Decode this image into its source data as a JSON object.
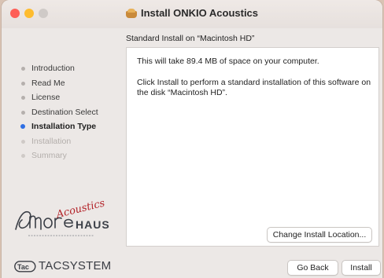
{
  "window": {
    "title": "Install ONKIO Acoustics",
    "subtitle": "Standard Install on “Macintosh HD”"
  },
  "sidebar": {
    "items": [
      {
        "label": "Introduction",
        "state": "done"
      },
      {
        "label": "Read Me",
        "state": "done"
      },
      {
        "label": "License",
        "state": "done"
      },
      {
        "label": "Destination Select",
        "state": "done"
      },
      {
        "label": "Installation Type",
        "state": "active"
      },
      {
        "label": "Installation",
        "state": "pending"
      },
      {
        "label": "Summary",
        "state": "pending"
      }
    ]
  },
  "content": {
    "space_text": "This will take 89.4 MB of space on your computer.",
    "body_text": "Click Install to perform a standard installation of this software on the disk “Macintosh HD”."
  },
  "buttons": {
    "change_location": "Change Install Location...",
    "go_back": "Go Back",
    "install": "Install"
  },
  "branding": {
    "logo_main": "AMORE",
    "logo_script": "Acoustics",
    "logo_sub": "HAUS",
    "tac_logo": "TACSYSTEM",
    "tac_mark": "Tac"
  },
  "colors": {
    "active_dot": "#2f6fe4",
    "close": "#fe5f57",
    "minimize": "#febc2e",
    "zoom": "#cfcac7",
    "logo_red": "#b3242a"
  }
}
